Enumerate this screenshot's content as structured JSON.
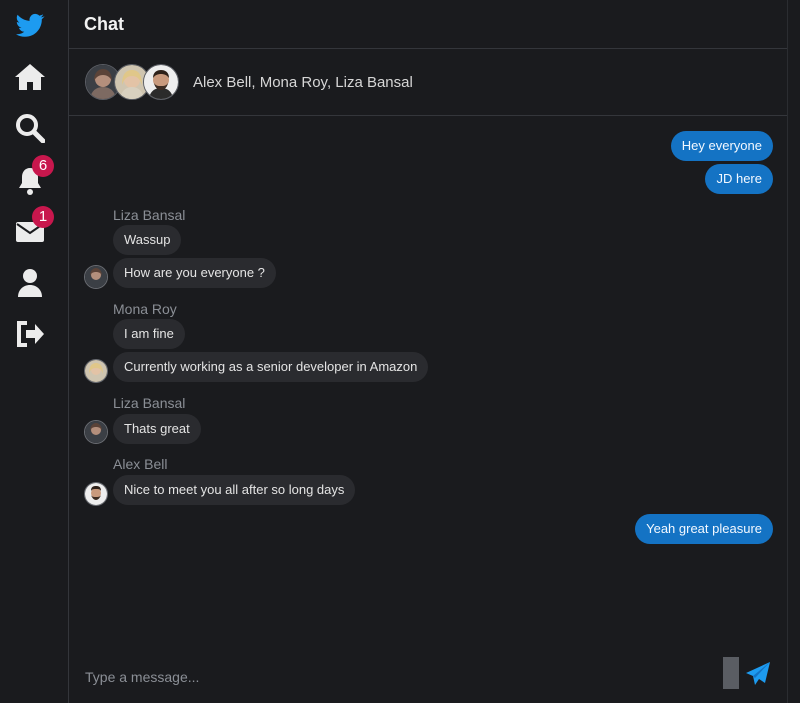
{
  "app": {
    "brand_color": "#1d9bf0",
    "accent": "#1473c4",
    "badge_color": "#c8174d"
  },
  "sidebar": {
    "items": [
      {
        "name": "logo",
        "icon": "bird-icon"
      },
      {
        "name": "home",
        "icon": "home-icon"
      },
      {
        "name": "search",
        "icon": "search-icon"
      },
      {
        "name": "notifications",
        "icon": "bell-icon",
        "badge": "6"
      },
      {
        "name": "messages",
        "icon": "envelope-icon",
        "badge": "1"
      },
      {
        "name": "profile",
        "icon": "user-icon"
      },
      {
        "name": "logout",
        "icon": "sign-out-icon"
      }
    ]
  },
  "header": {
    "title": "Chat"
  },
  "conversation": {
    "participants": "Alex Bell, Mona Roy, Liza Bansal"
  },
  "messages": [
    {
      "from": "me",
      "text": "Hey everyone"
    },
    {
      "from": "me",
      "text": "JD here"
    },
    {
      "from": "Liza Bansal",
      "sender_label": "Liza Bansal",
      "text": "Wassup"
    },
    {
      "from": "Liza Bansal",
      "text": "How are you everyone ?"
    },
    {
      "from": "Mona Roy",
      "sender_label": "Mona Roy",
      "text": "I am fine"
    },
    {
      "from": "Mona Roy",
      "text": "Currently working as a senior developer in Amazon"
    },
    {
      "from": "Liza Bansal",
      "sender_label": "Liza Bansal",
      "text": "Thats great"
    },
    {
      "from": "Alex Bell",
      "sender_label": "Alex Bell",
      "text": "Nice to meet you all after so long days"
    },
    {
      "from": "me",
      "text": "Yeah great pleasure"
    }
  ],
  "composer": {
    "placeholder": "Type a message...",
    "send_icon": "paper-plane-icon"
  }
}
